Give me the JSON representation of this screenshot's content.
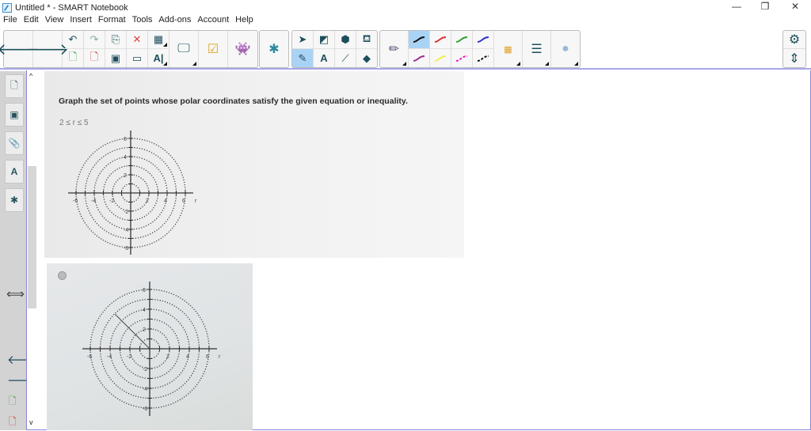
{
  "window": {
    "title": "Untitled * - SMART Notebook",
    "min": "—",
    "restore": "❐",
    "close": "✕"
  },
  "menu": [
    "File",
    "Edit",
    "View",
    "Insert",
    "Format",
    "Tools",
    "Add-ons",
    "Account",
    "Help"
  ],
  "toolbar": {
    "text_tool": "A",
    "pen_colors": [
      "#111111",
      "#e03030",
      "#30a030",
      "#3030d0",
      "#a03090",
      "#f0f050",
      "#e020c0",
      "#111111"
    ]
  },
  "sidebar": {
    "scroll_up": "^",
    "scroll_down": "v"
  },
  "content": {
    "question": "Graph the set of points whose polar coordinates satisfy the given equation or inequality.",
    "inequality": "2 ≤ r ≤ 5",
    "axis_ticks": [
      "-6",
      "-4",
      "-2",
      "2",
      "4",
      "6"
    ],
    "axis_letter_x": "r"
  }
}
